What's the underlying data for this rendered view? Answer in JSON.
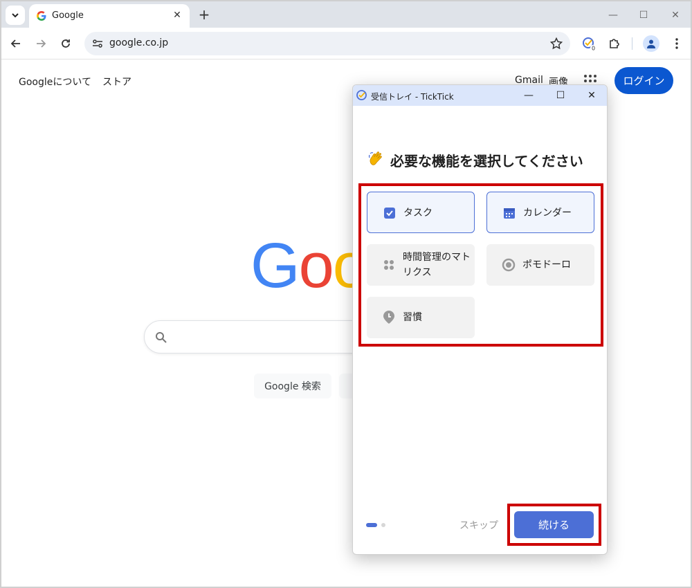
{
  "browser": {
    "tab": {
      "title": "Google"
    },
    "url": "google.co.jp",
    "extension_badge": "0"
  },
  "google": {
    "top_left_links": [
      "Googleについて",
      "ストア"
    ],
    "top_right_links": [
      "Gmail",
      "画像"
    ],
    "login_label": "ログイン",
    "logo_text": "Goog",
    "search_button": "Google 検索",
    "colors": {
      "blue": "#4285f4",
      "red": "#ea4335",
      "yellow": "#fbbc05",
      "green": "#34a853",
      "login": "#0b57d0"
    }
  },
  "dialog": {
    "window_title": "受信トレイ - TickTick",
    "heading": "必要な機能を選択してください",
    "heading_icon": "waving-hand-icon",
    "options": [
      {
        "label": "タスク",
        "icon": "checkbox-icon",
        "selected": true
      },
      {
        "label": "カレンダー",
        "icon": "calendar-icon",
        "selected": true
      },
      {
        "label": "時間管理のマトリクス",
        "icon": "matrix-icon",
        "selected": false
      },
      {
        "label": "ポモドーロ",
        "icon": "pomodoro-icon",
        "selected": false
      },
      {
        "label": "習慣",
        "icon": "habit-icon",
        "selected": false
      }
    ],
    "skip_label": "スキップ",
    "continue_label": "続ける",
    "accent_color": "#4c6fd6",
    "highlight_color": "#cc0000"
  }
}
